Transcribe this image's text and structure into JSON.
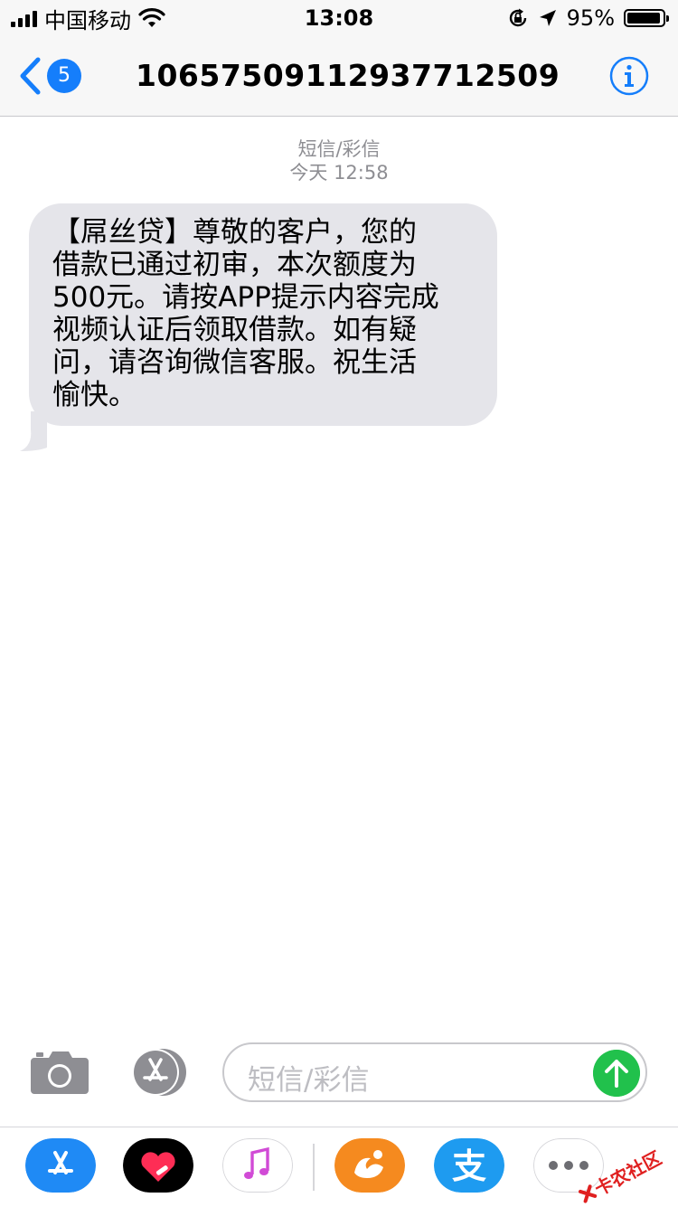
{
  "status_bar": {
    "carrier": "中国移动",
    "time": "13:08",
    "battery_percent": "95%",
    "battery_level": 0.95,
    "icons": [
      "signal-bars-icon",
      "wifi-icon",
      "orientation-lock-icon",
      "location-arrow-icon",
      "battery-icon"
    ]
  },
  "nav": {
    "back_badge": "5",
    "title": "10657509112937712509",
    "info_icon": "info-icon"
  },
  "conversation": {
    "service_label": "短信/彩信",
    "timestamp": "今天 12:58",
    "messages": [
      {
        "direction": "incoming",
        "text": "【屌丝贷】尊敬的客户，您的\n借款已通过初审，本次额度为\n500元。请按APP提示内容完成\n视频认证后领取借款。如有疑\n问，请咨询微信客服。祝生活\n愉快。"
      }
    ]
  },
  "composer": {
    "placeholder": "短信/彩信",
    "send_icon": "send-arrow-icon"
  },
  "dock": {
    "apps": [
      "app-store-icon",
      "digital-touch-icon",
      "music-icon",
      "uc-browser-icon",
      "alipay-icon",
      "more-apps-icon"
    ],
    "alipay_glyph": "支"
  },
  "watermark": {
    "text": "卡农社区"
  },
  "colors": {
    "accent": "#157efb",
    "bubble_incoming": "#e5e5ea",
    "send": "#21c14c",
    "meta_gray": "#8e8e93"
  }
}
